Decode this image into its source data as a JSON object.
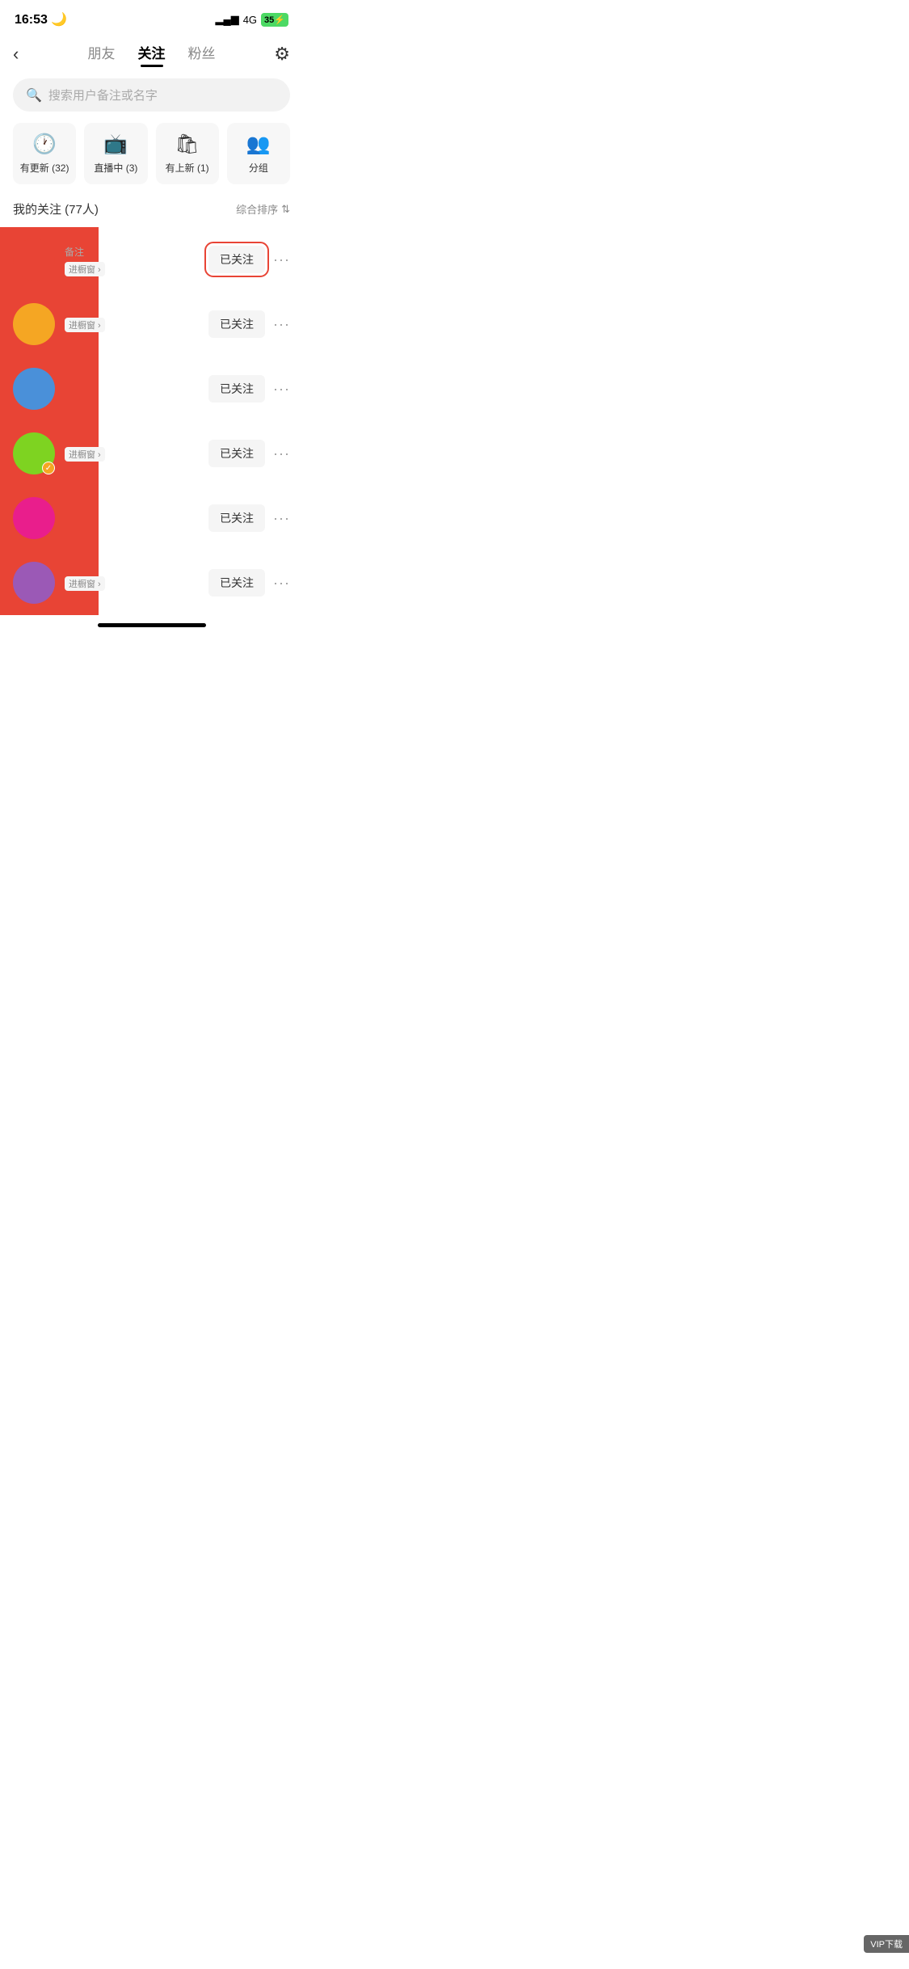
{
  "statusBar": {
    "time": "16:53",
    "moonIcon": "🌙",
    "signal": "▂▄▆",
    "network": "4G",
    "battery": "35"
  },
  "nav": {
    "backIcon": "‹",
    "tabs": [
      {
        "label": "朋友",
        "active": false
      },
      {
        "label": "关注",
        "active": true
      },
      {
        "label": "粉丝",
        "active": false
      }
    ],
    "settingsIcon": "⚙"
  },
  "search": {
    "placeholder": "搜索用户备注或名字"
  },
  "filterCards": [
    {
      "icon": "🕐",
      "label": "有更新 (32)"
    },
    {
      "icon": "📺",
      "label": "直播中 (3)"
    },
    {
      "icon": "🛍",
      "label": "有上新 (1)"
    },
    {
      "icon": "👥",
      "label": "分组"
    }
  ],
  "section": {
    "title": "我的关注 (77人)",
    "sort": "综合排序"
  },
  "users": [
    {
      "id": 1,
      "avatarColor": "red-bg",
      "name": "",
      "note": "备注",
      "shop": "进橱窗",
      "followLabel": "已关注",
      "circled": true,
      "verified": false
    },
    {
      "id": 2,
      "avatarColor": "orange-bg",
      "name": "",
      "note": "",
      "shop": "进橱窗",
      "followLabel": "已关注",
      "circled": false,
      "verified": false
    },
    {
      "id": 3,
      "avatarColor": "blue-bg",
      "name": "",
      "note": "",
      "shop": "",
      "followLabel": "已关注",
      "circled": false,
      "verified": false
    },
    {
      "id": 4,
      "avatarColor": "green-bg",
      "name": "",
      "note": "",
      "shop": "进橱窗",
      "followLabel": "已关注",
      "circled": false,
      "verified": true
    },
    {
      "id": 5,
      "avatarColor": "pink-bg",
      "name": "",
      "note": "",
      "shop": "",
      "followLabel": "已关注",
      "circled": false,
      "verified": false
    },
    {
      "id": 6,
      "avatarColor": "purple-bg",
      "name": "",
      "note": "",
      "shop": "进橱窗",
      "followLabel": "已关注",
      "circled": false,
      "verified": false
    }
  ],
  "watermark": "VIP下载"
}
